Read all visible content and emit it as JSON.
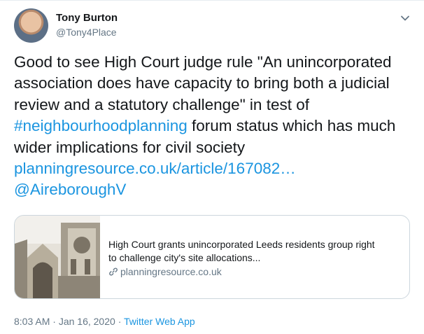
{
  "author": {
    "name": "Tony Burton",
    "handle": "@Tony4Place"
  },
  "body_lines": [
    {
      "parts": [
        {
          "t": "Good to see High Court judge rule \"An unincorporated",
          "link": false
        }
      ]
    },
    {
      "parts": [
        {
          "t": "association does have capacity to bring both a judicial",
          "link": false
        }
      ]
    },
    {
      "parts": [
        {
          "t": "review and a statutory challenge\" in test of",
          "link": false
        }
      ]
    },
    {
      "parts": [
        {
          "t": "#neighbourhoodplanning",
          "link": true
        },
        {
          "t": " forum status which has much",
          "link": false
        }
      ]
    },
    {
      "parts": [
        {
          "t": "wider implications for civil society",
          "link": false
        }
      ]
    },
    {
      "parts": [
        {
          "t": "planningresource.co.uk/article/167082…",
          "link": true
        }
      ]
    },
    {
      "parts": [
        {
          "t": "@AireboroughV",
          "link": true
        }
      ]
    }
  ],
  "card": {
    "title_lines": [
      "High Court grants unincorporated Leeds residents group right",
      "to challenge city's site allocations..."
    ],
    "domain": "planningresource.co.uk"
  },
  "meta": {
    "time": "8:03 AM",
    "date": "Jan 16, 2020",
    "separator": "·",
    "source": "Twitter Web App"
  },
  "icons": {
    "menu": "chevron-down-icon",
    "link": "chain-link-icon"
  },
  "colors": {
    "link": "#1b95e0",
    "text": "#14171a",
    "muted": "#657786",
    "border": "#ccd6dd"
  }
}
